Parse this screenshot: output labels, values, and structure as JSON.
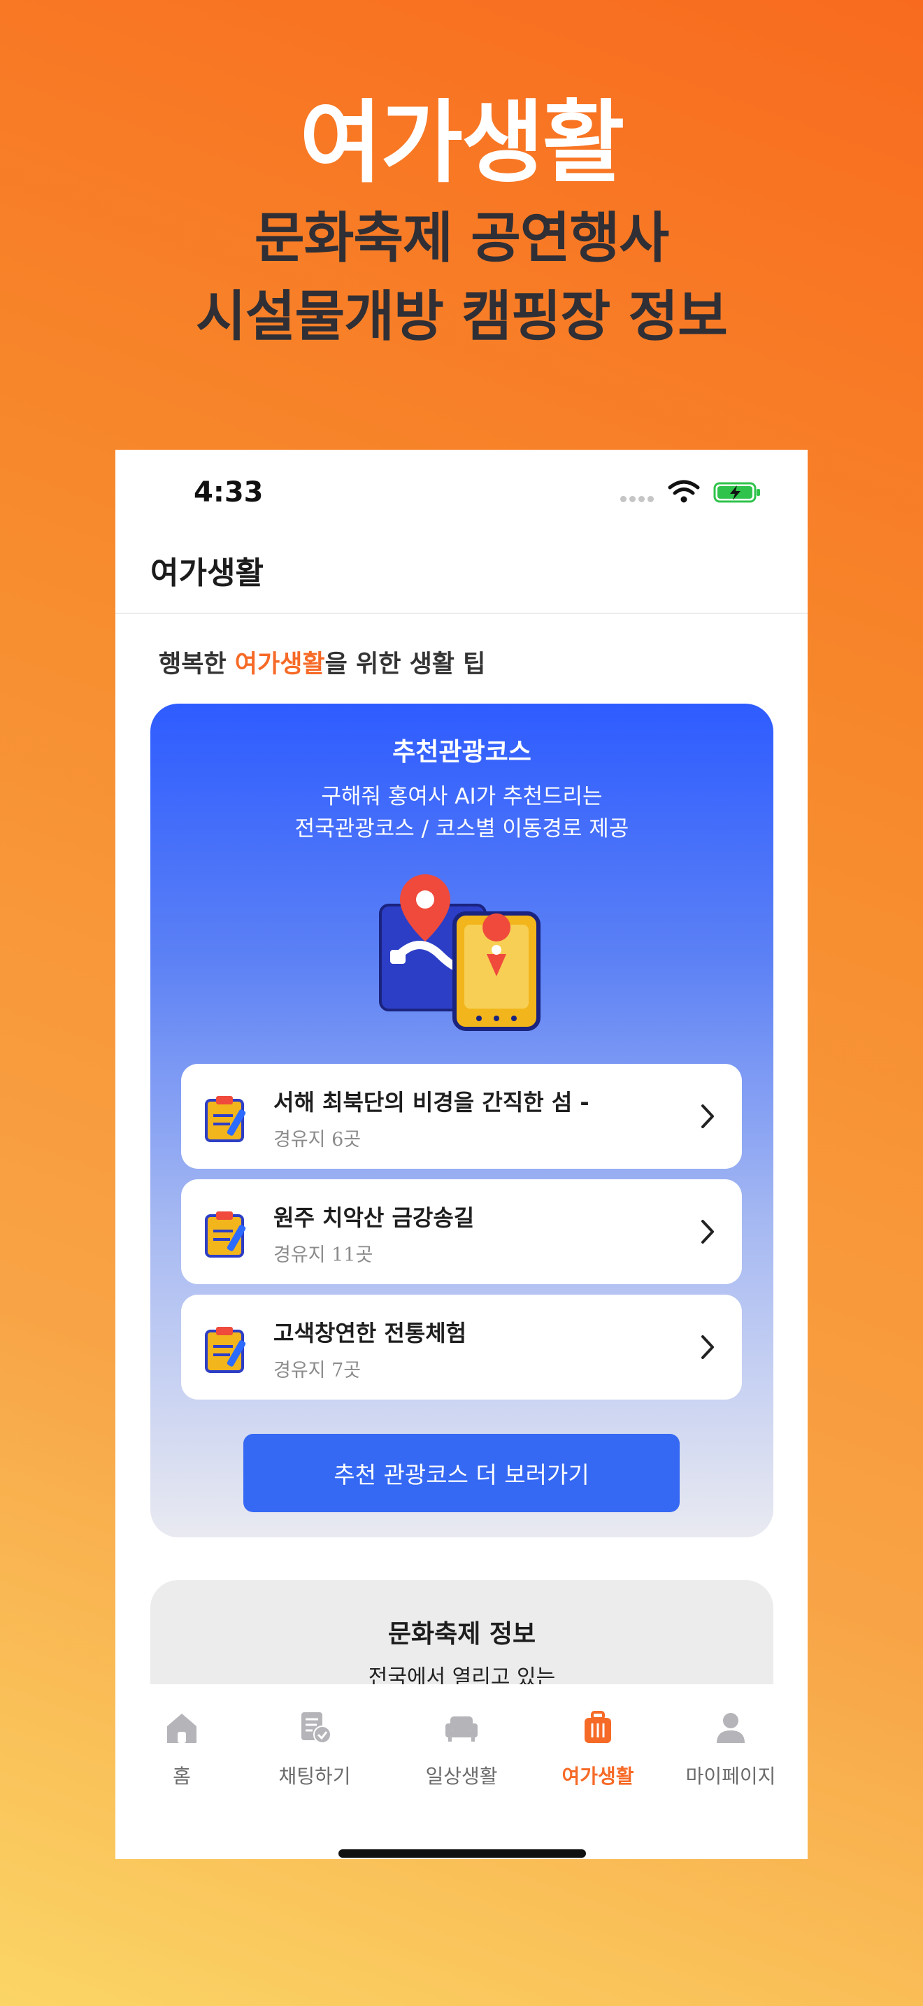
{
  "promo": {
    "title": "여가생활",
    "subtitle_line1": "문화축제 공연행사",
    "subtitle_line2": "시설물개방 캠핑장 정보"
  },
  "status_bar": {
    "time": "4:33",
    "battery_color": "#2fc34b"
  },
  "header": {
    "title": "여가생활"
  },
  "tips": {
    "prefix": "행복한 ",
    "highlight": "여가생활",
    "suffix": "을 위한 생활 팁"
  },
  "course_card": {
    "title": "추천관광코스",
    "desc_line1": "구해줘 홍여사 AI가 추천드리는",
    "desc_line2": "전국관광코스 / 코스별 이동경로 제공",
    "items": [
      {
        "name": "서해 최북단의 비경을 간직한 섬 -",
        "meta": "경유지 6곳"
      },
      {
        "name": "원주 치악산 금강송길",
        "meta": "경유지 11곳"
      },
      {
        "name": "고색창연한 전통체험",
        "meta": "경유지 7곳"
      }
    ],
    "more_button": "추천 관광코스 더 보러가기"
  },
  "festival_card": {
    "title": "문화축제 정보",
    "desc": "전국에서 열리고 있는"
  },
  "tab_bar": {
    "accent": "#f66a27",
    "tabs": [
      {
        "label": "홈",
        "icon": "home-icon"
      },
      {
        "label": "채팅하기",
        "icon": "chat-document-icon"
      },
      {
        "label": "일상생활",
        "icon": "sofa-icon"
      },
      {
        "label": "여가생활",
        "icon": "suitcase-icon"
      },
      {
        "label": "마이페이지",
        "icon": "person-icon"
      }
    ]
  }
}
